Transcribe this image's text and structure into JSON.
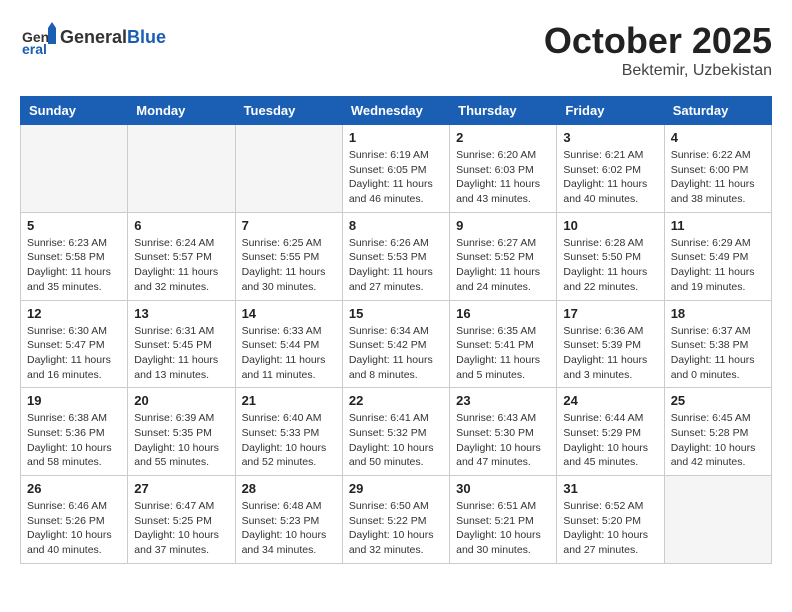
{
  "header": {
    "logo_general": "General",
    "logo_blue": "Blue",
    "month_year": "October 2025",
    "location": "Bektemir, Uzbekistan"
  },
  "days_of_week": [
    "Sunday",
    "Monday",
    "Tuesday",
    "Wednesday",
    "Thursday",
    "Friday",
    "Saturday"
  ],
  "weeks": [
    [
      {
        "day": "",
        "info": ""
      },
      {
        "day": "",
        "info": ""
      },
      {
        "day": "",
        "info": ""
      },
      {
        "day": "1",
        "info": "Sunrise: 6:19 AM\nSunset: 6:05 PM\nDaylight: 11 hours and 46 minutes."
      },
      {
        "day": "2",
        "info": "Sunrise: 6:20 AM\nSunset: 6:03 PM\nDaylight: 11 hours and 43 minutes."
      },
      {
        "day": "3",
        "info": "Sunrise: 6:21 AM\nSunset: 6:02 PM\nDaylight: 11 hours and 40 minutes."
      },
      {
        "day": "4",
        "info": "Sunrise: 6:22 AM\nSunset: 6:00 PM\nDaylight: 11 hours and 38 minutes."
      }
    ],
    [
      {
        "day": "5",
        "info": "Sunrise: 6:23 AM\nSunset: 5:58 PM\nDaylight: 11 hours and 35 minutes."
      },
      {
        "day": "6",
        "info": "Sunrise: 6:24 AM\nSunset: 5:57 PM\nDaylight: 11 hours and 32 minutes."
      },
      {
        "day": "7",
        "info": "Sunrise: 6:25 AM\nSunset: 5:55 PM\nDaylight: 11 hours and 30 minutes."
      },
      {
        "day": "8",
        "info": "Sunrise: 6:26 AM\nSunset: 5:53 PM\nDaylight: 11 hours and 27 minutes."
      },
      {
        "day": "9",
        "info": "Sunrise: 6:27 AM\nSunset: 5:52 PM\nDaylight: 11 hours and 24 minutes."
      },
      {
        "day": "10",
        "info": "Sunrise: 6:28 AM\nSunset: 5:50 PM\nDaylight: 11 hours and 22 minutes."
      },
      {
        "day": "11",
        "info": "Sunrise: 6:29 AM\nSunset: 5:49 PM\nDaylight: 11 hours and 19 minutes."
      }
    ],
    [
      {
        "day": "12",
        "info": "Sunrise: 6:30 AM\nSunset: 5:47 PM\nDaylight: 11 hours and 16 minutes."
      },
      {
        "day": "13",
        "info": "Sunrise: 6:31 AM\nSunset: 5:45 PM\nDaylight: 11 hours and 13 minutes."
      },
      {
        "day": "14",
        "info": "Sunrise: 6:33 AM\nSunset: 5:44 PM\nDaylight: 11 hours and 11 minutes."
      },
      {
        "day": "15",
        "info": "Sunrise: 6:34 AM\nSunset: 5:42 PM\nDaylight: 11 hours and 8 minutes."
      },
      {
        "day": "16",
        "info": "Sunrise: 6:35 AM\nSunset: 5:41 PM\nDaylight: 11 hours and 5 minutes."
      },
      {
        "day": "17",
        "info": "Sunrise: 6:36 AM\nSunset: 5:39 PM\nDaylight: 11 hours and 3 minutes."
      },
      {
        "day": "18",
        "info": "Sunrise: 6:37 AM\nSunset: 5:38 PM\nDaylight: 11 hours and 0 minutes."
      }
    ],
    [
      {
        "day": "19",
        "info": "Sunrise: 6:38 AM\nSunset: 5:36 PM\nDaylight: 10 hours and 58 minutes."
      },
      {
        "day": "20",
        "info": "Sunrise: 6:39 AM\nSunset: 5:35 PM\nDaylight: 10 hours and 55 minutes."
      },
      {
        "day": "21",
        "info": "Sunrise: 6:40 AM\nSunset: 5:33 PM\nDaylight: 10 hours and 52 minutes."
      },
      {
        "day": "22",
        "info": "Sunrise: 6:41 AM\nSunset: 5:32 PM\nDaylight: 10 hours and 50 minutes."
      },
      {
        "day": "23",
        "info": "Sunrise: 6:43 AM\nSunset: 5:30 PM\nDaylight: 10 hours and 47 minutes."
      },
      {
        "day": "24",
        "info": "Sunrise: 6:44 AM\nSunset: 5:29 PM\nDaylight: 10 hours and 45 minutes."
      },
      {
        "day": "25",
        "info": "Sunrise: 6:45 AM\nSunset: 5:28 PM\nDaylight: 10 hours and 42 minutes."
      }
    ],
    [
      {
        "day": "26",
        "info": "Sunrise: 6:46 AM\nSunset: 5:26 PM\nDaylight: 10 hours and 40 minutes."
      },
      {
        "day": "27",
        "info": "Sunrise: 6:47 AM\nSunset: 5:25 PM\nDaylight: 10 hours and 37 minutes."
      },
      {
        "day": "28",
        "info": "Sunrise: 6:48 AM\nSunset: 5:23 PM\nDaylight: 10 hours and 34 minutes."
      },
      {
        "day": "29",
        "info": "Sunrise: 6:50 AM\nSunset: 5:22 PM\nDaylight: 10 hours and 32 minutes."
      },
      {
        "day": "30",
        "info": "Sunrise: 6:51 AM\nSunset: 5:21 PM\nDaylight: 10 hours and 30 minutes."
      },
      {
        "day": "31",
        "info": "Sunrise: 6:52 AM\nSunset: 5:20 PM\nDaylight: 10 hours and 27 minutes."
      },
      {
        "day": "",
        "info": ""
      }
    ]
  ]
}
